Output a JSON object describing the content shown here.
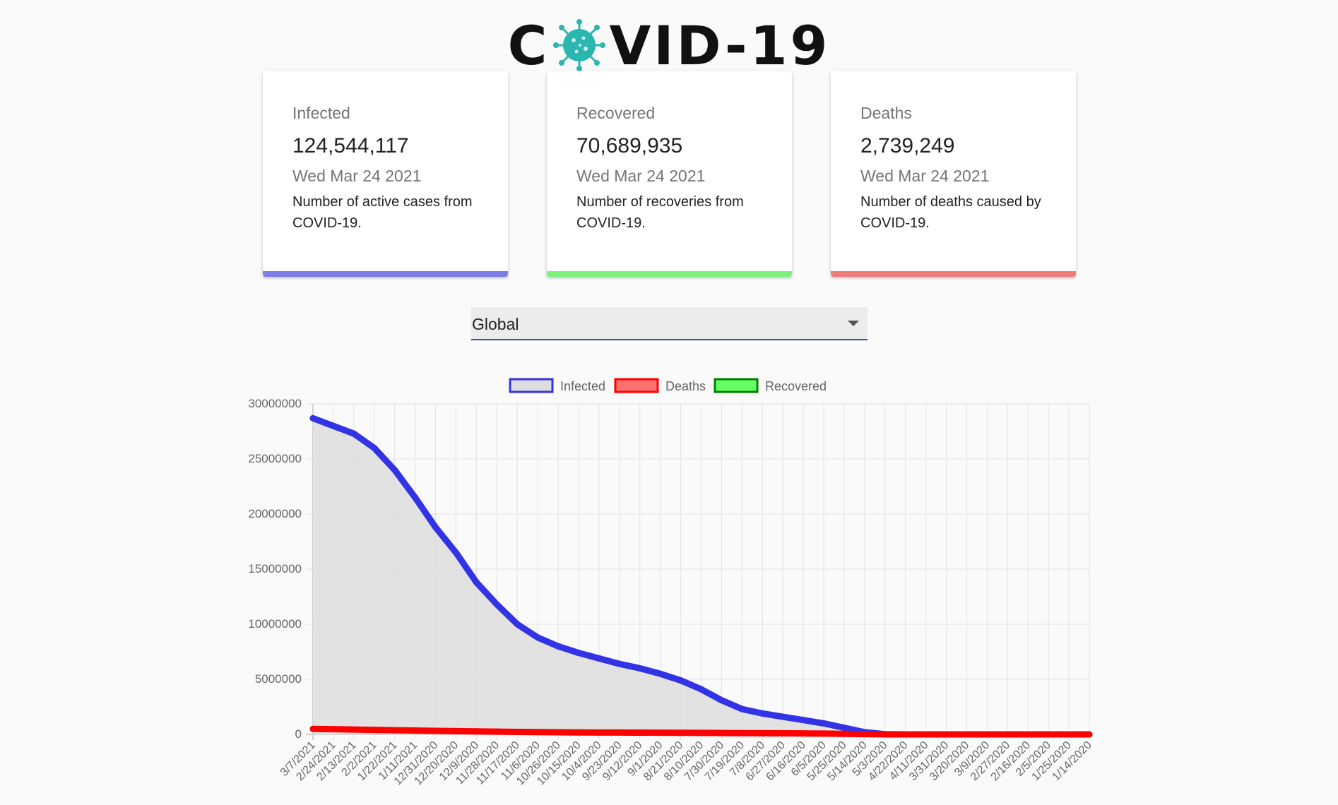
{
  "header": {
    "title_prefix": "C",
    "title_suffix": "VID-19",
    "logo_icon": "virus-icon"
  },
  "cards": [
    {
      "title": "Infected",
      "value": "124,544,117",
      "date": "Wed Mar 24 2021",
      "description": "Number of active cases from COVID-19.",
      "accent": "#7b7fe6"
    },
    {
      "title": "Recovered",
      "value": "70,689,935",
      "date": "Wed Mar 24 2021",
      "description": "Number of recoveries from COVID-19.",
      "accent": "#7ef07e"
    },
    {
      "title": "Deaths",
      "value": "2,739,249",
      "date": "Wed Mar 24 2021",
      "description": "Number of deaths caused by COVID-19.",
      "accent": "#f07b7b"
    }
  ],
  "country_picker": {
    "selected": "Global",
    "icon": "chevron-down-icon"
  },
  "chart_data": {
    "type": "line",
    "title": "",
    "xlabel": "",
    "ylabel": "",
    "ylim": [
      0,
      30000000
    ],
    "yticks": [
      "0",
      "5000000",
      "10000000",
      "15000000",
      "20000000",
      "25000000",
      "30000000"
    ],
    "grid": true,
    "legend_position": "top",
    "categories": [
      "3/7/2021",
      "2/24/2021",
      "2/13/2021",
      "2/2/2021",
      "1/22/2021",
      "1/11/2021",
      "12/31/2020",
      "12/20/2020",
      "12/9/2020",
      "11/28/2020",
      "11/17/2020",
      "11/6/2020",
      "10/26/2020",
      "10/15/2020",
      "10/4/2020",
      "9/23/2020",
      "9/12/2020",
      "9/1/2020",
      "8/21/2020",
      "8/10/2020",
      "7/30/2020",
      "7/19/2020",
      "7/8/2020",
      "6/27/2020",
      "6/16/2020",
      "6/5/2020",
      "5/25/2020",
      "5/14/2020",
      "5/3/2020",
      "4/22/2020",
      "4/11/2020",
      "3/31/2020",
      "3/20/2020",
      "3/9/2020",
      "2/27/2020",
      "2/16/2020",
      "2/5/2020",
      "1/25/2020",
      "1/14/2020"
    ],
    "series": [
      {
        "name": "Infected",
        "color": "#3333e6",
        "fill": "#dddddd",
        "values": [
          28700000,
          28000000,
          27300000,
          26000000,
          24000000,
          21500000,
          18800000,
          16500000,
          13800000,
          11800000,
          10000000,
          8800000,
          8000000,
          7400000,
          6900000,
          6400000,
          6000000,
          5500000,
          4900000,
          4100000,
          3100000,
          2300000,
          1900000,
          1600000,
          1300000,
          1000000,
          600000,
          200000,
          20000,
          0,
          0,
          0,
          0,
          0,
          0,
          0,
          0,
          0,
          0
        ]
      },
      {
        "name": "Deaths",
        "color": "#ff0000",
        "fill": "#ff7070",
        "values": [
          500000,
          470000,
          440000,
          410000,
          380000,
          350000,
          320000,
          295000,
          270000,
          245000,
          225000,
          205000,
          190000,
          180000,
          172000,
          165000,
          158000,
          150000,
          142000,
          133000,
          124000,
          115000,
          105000,
          95000,
          85000,
          75000,
          50000,
          25000,
          5000,
          0,
          0,
          0,
          0,
          0,
          0,
          0,
          0,
          0,
          0
        ]
      },
      {
        "name": "Recovered",
        "color": "#008000",
        "fill": "#66ff66",
        "values": []
      }
    ]
  }
}
